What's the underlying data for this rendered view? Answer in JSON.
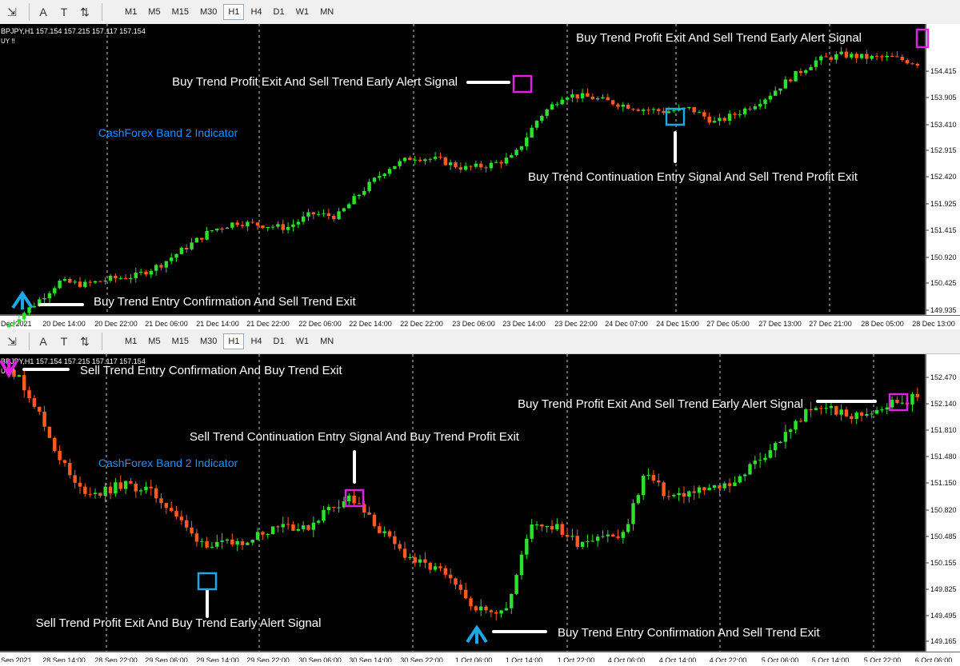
{
  "toolbar": {
    "icons": [
      "chart-objects-icon",
      "font-icon",
      "text-label-icon",
      "arrows-dropdown-icon"
    ],
    "icon_glyphs": [
      "⇲",
      "A",
      "T",
      "⇅"
    ],
    "timeframes": [
      "M1",
      "M5",
      "M15",
      "M30",
      "H1",
      "H4",
      "D1",
      "W1",
      "MN"
    ],
    "active_timeframe": "H1"
  },
  "colors": {
    "background": "#000000",
    "bull": "#2ee02e",
    "bear": "#ff5a1f",
    "annotation_text": "#ffffff",
    "indicator_label": "#1e90ff",
    "magenta_box": "#e020e0",
    "cyan_box": "#1ea7e8",
    "cyan_arrow": "#1ea7e8",
    "grid_separator": "#ffffff"
  },
  "charts": [
    {
      "info": "BPJPY,H1  157.154 157.215 157.117 157.154",
      "info2": "UY !!",
      "indicator_label": "CashForex Band 2 Indicator",
      "price_labels": [
        "154.415",
        "153.905",
        "153.410",
        "152.915",
        "152.420",
        "151.925",
        "151.415",
        "150.920",
        "150.425",
        "149.935"
      ],
      "time_labels": [
        "Dec 2021",
        "20 Dec 14:00",
        "20 Dec 22:00",
        "21 Dec 06:00",
        "21 Dec 14:00",
        "21 Dec 22:00",
        "22 Dec 06:00",
        "22 Dec 14:00",
        "22 Dec 22:00",
        "23 Dec 06:00",
        "23 Dec 14:00",
        "23 Dec 22:00",
        "24 Dec 07:00",
        "24 Dec 15:00",
        "27 Dec 05:00",
        "27 Dec 13:00",
        "27 Dec 21:00",
        "28 Dec 05:00",
        "28 Dec 13:00"
      ],
      "annotations": [
        "Buy Trend Profit Exit And Sell Trend Early Alert Signal",
        "Buy Trend Profit Exit And Sell Trend Early Alert Signal",
        "Buy Trend Continuation Entry Signal And Sell Trend Profit Exit",
        "Buy Trend Entry Confirmation And Sell Trend Exit"
      ]
    },
    {
      "info": "BPJPY,H1  157.154 157.215 157.117 157.154",
      "info2": "UY !!",
      "indicator_label": "CashForex Band 2 Indicator",
      "price_labels": [
        "152.470",
        "152.140",
        "151.810",
        "151.480",
        "151.150",
        "150.820",
        "150.485",
        "150.155",
        "149.825",
        "149.495",
        "149.165"
      ],
      "time_labels": [
        "Sep 2021",
        "28 Sep 14:00",
        "28 Sep 22:00",
        "29 Sep 06:00",
        "29 Sep 14:00",
        "29 Sep 22:00",
        "30 Sep 06:00",
        "30 Sep 14:00",
        "30 Sep 22:00",
        "1 Oct 06:00",
        "1 Oct 14:00",
        "1 Oct 22:00",
        "4 Oct 06:00",
        "4 Oct 14:00",
        "4 Oct 22:00",
        "5 Oct 06:00",
        "5 Oct 14:00",
        "5 Oct 22:00",
        "6 Oct 06:00"
      ],
      "annotations": [
        "Sell Trend Entry Confirmation And Buy Trend Exit",
        "Sell Trend Continuation Entry Signal And Buy Trend Profit Exit",
        "Buy Trend Profit Exit And Sell Trend Early Alert Signal",
        "Sell Trend Profit Exit And Buy Trend Early Alert Signal",
        "Buy Trend Entry Confirmation And Sell Trend Exit"
      ]
    }
  ],
  "chart_data": [
    {
      "type": "candlestick",
      "symbol": "BPJPY,H1",
      "ylim": [
        149.7,
        154.8
      ],
      "close_path": [
        149.55,
        149.9,
        150.3,
        150.25,
        150.35,
        150.4,
        150.6,
        150.9,
        151.2,
        151.35,
        151.3,
        151.25,
        151.5,
        151.45,
        151.9,
        152.3,
        152.5,
        152.45,
        152.3,
        152.35,
        152.5,
        153.2,
        153.6,
        153.55,
        153.45,
        153.35,
        153.3,
        153.35,
        153.1,
        153.3,
        153.55,
        153.9,
        154.2,
        154.3,
        154.25,
        154.25,
        154.15
      ],
      "signals": [
        {
          "label": "Buy Trend Entry Confirmation And Sell Trend Exit",
          "time": "20 Dec 2021",
          "marker": "cyan-arrow"
        },
        {
          "label": "Buy Trend Profit Exit And Sell Trend Early Alert Signal",
          "time": "23 Dec 14:00",
          "marker": "magenta-box"
        },
        {
          "label": "Buy Trend Continuation Entry Signal And Sell Trend Profit Exit",
          "time": "24 Dec 15:00",
          "marker": "cyan-box"
        },
        {
          "label": "Buy Trend Profit Exit And Sell Trend Early Alert Signal",
          "time": "28 Dec 13:00",
          "marker": "magenta-box"
        }
      ]
    },
    {
      "type": "candlestick",
      "symbol": "BPJPY,H1",
      "ylim": [
        149.1,
        152.6
      ],
      "close_path": [
        152.5,
        152.1,
        151.5,
        151.0,
        150.95,
        151.05,
        151.0,
        150.8,
        150.45,
        150.3,
        150.35,
        150.45,
        150.6,
        150.5,
        150.75,
        150.9,
        150.6,
        150.3,
        150.1,
        150.0,
        149.7,
        149.5,
        149.6,
        150.6,
        150.55,
        150.35,
        150.45,
        150.4,
        151.2,
        150.9,
        150.95,
        151.0,
        151.1,
        151.35,
        151.6,
        151.9,
        152.0,
        151.85,
        151.95,
        152.05,
        152.1
      ],
      "signals": [
        {
          "label": "Sell Trend Entry Confirmation And Buy Trend Exit",
          "time": "28 Sep 2021",
          "marker": "magenta-arrow"
        },
        {
          "label": "Sell Trend Profit Exit And Buy Trend Early Alert Signal",
          "time": "29 Sep 14:00",
          "marker": "cyan-box"
        },
        {
          "label": "Sell Trend Continuation Entry Signal And Buy Trend Profit Exit",
          "time": "30 Sep 14:00",
          "marker": "magenta-box"
        },
        {
          "label": "Buy Trend Entry Confirmation And Sell Trend Exit",
          "time": "1 Oct 06:00",
          "marker": "cyan-arrow"
        },
        {
          "label": "Buy Trend Profit Exit And Sell Trend Early Alert Signal",
          "time": "6 Oct 06:00",
          "marker": "magenta-box"
        }
      ]
    }
  ]
}
